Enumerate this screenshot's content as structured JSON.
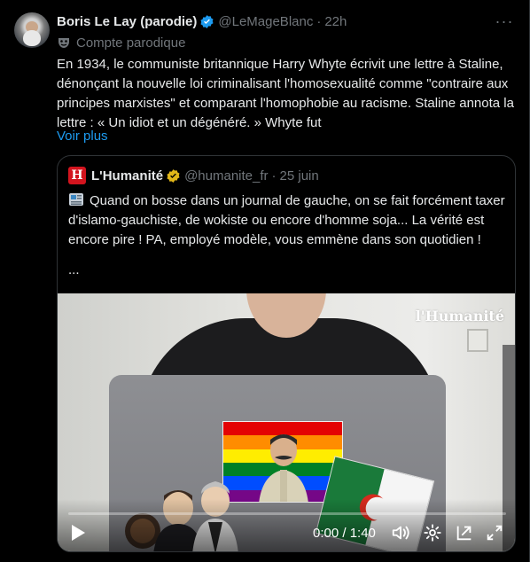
{
  "tweet": {
    "display_name": "Boris Le Lay (parodie)",
    "handle": "@LeMageBlanc",
    "separator": "·",
    "time": "22h",
    "parody_label": "Compte parodique",
    "text": "En 1934, le communiste britannique Harry Whyte écrivit une lettre à Staline, dénonçant la nouvelle loi criminalisant l'homosexualité comme \"contraire aux principes marxistes\" et comparant l'homophobie au racisme. Staline annota la lettre : « Un idiot et un dégénéré. » Whyte fut",
    "show_more": "Voir plus",
    "more_icon": "···"
  },
  "quote": {
    "logo_letter": "H",
    "display_name": "L'Humanité",
    "handle": "@humanite_fr",
    "separator": "·",
    "time": "25 juin",
    "text": "Quand on bosse dans un journal de gauche, on se fait forcément taxer d'islamo-gauchiste, de wokiste ou encore d'homme soja... La vérité est encore pire ! PA, employé modèle, vous emmène dans son quotidien !",
    "ellipsis": "...",
    "video": {
      "watermark": "l'Humanité",
      "time_display": "0:00 / 1:40",
      "progress": 0
    }
  },
  "colors": {
    "background": "#000000",
    "text": "#e7e9ea",
    "muted": "#71767b",
    "link": "#1d9bf0",
    "verified_blue": "#1d9bf0",
    "verified_gold": "#e2b719",
    "humanite_red": "#d3141e",
    "border": "#2f3336"
  },
  "icons": {
    "verified": "verified-badge-icon",
    "parody": "parody-mask-icon",
    "more": "more-options-icon",
    "play": "play-icon",
    "volume": "volume-icon",
    "settings": "gear-icon",
    "pip": "picture-in-picture-icon",
    "fullscreen": "fullscreen-icon"
  }
}
